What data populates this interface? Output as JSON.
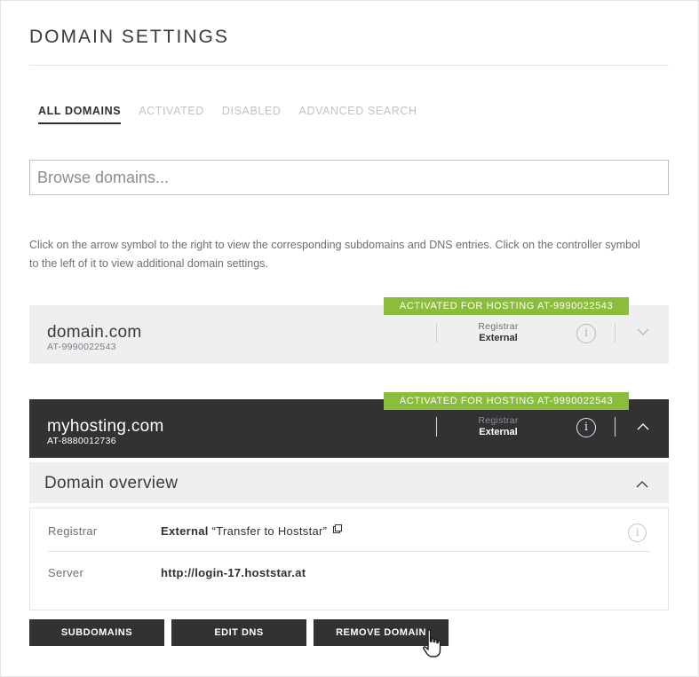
{
  "page": {
    "title": "DOMAIN SETTINGS"
  },
  "tabs": [
    {
      "label": "ALL DOMAINS",
      "active": true
    },
    {
      "label": "ACTIVATED",
      "active": false
    },
    {
      "label": "DISABLED",
      "active": false
    },
    {
      "label": "ADVANCED SEARCH",
      "active": false
    }
  ],
  "search": {
    "placeholder": "Browse domains...",
    "value": ""
  },
  "instructions": "Click on the arrow symbol to the right to view the corresponding subdomains and DNS entries. Click on the controller symbol to the left of it to view additional domain settings.",
  "domains": [
    {
      "name": "domain.com",
      "id": "AT-9990022543",
      "badge": "ACTIVATED FOR HOSTING AT-9990022543",
      "registrar_label": "Registrar",
      "registrar_value": "External",
      "expanded": false
    },
    {
      "name": "myhosting.com",
      "id": "AT-8880012736",
      "badge": "ACTIVATED FOR HOSTING AT-9990022543",
      "registrar_label": "Registrar",
      "registrar_value": "External",
      "expanded": true
    }
  ],
  "overview": {
    "title": "Domain overview",
    "registrar_label": "Registrar",
    "registrar_value": "External",
    "transfer_link": "“Transfer to Hoststar”",
    "server_label": "Server",
    "server_value": "http://login-17.hoststar.at"
  },
  "buttons": {
    "subdomains": "SUBDOMAINS",
    "edit_dns": "EDIT DNS",
    "remove_domain": "REMOVE DOMAIN"
  },
  "colors": {
    "accent_green": "#8bbd3c",
    "dark_row": "#323134",
    "light_row": "#efeff2"
  },
  "icons": {
    "info": "info-icon",
    "chevron_down": "chevron-down-icon",
    "chevron_up": "chevron-up-icon",
    "external_link": "external-link-icon",
    "cursor": "hand-cursor-icon"
  }
}
